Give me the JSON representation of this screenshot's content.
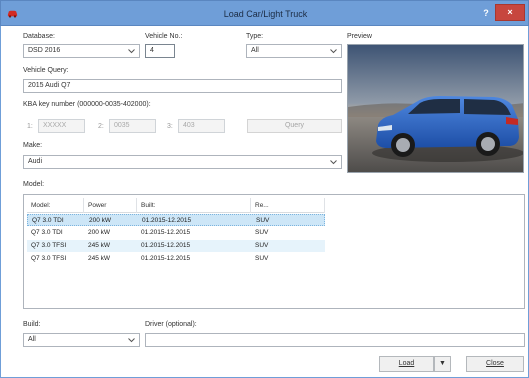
{
  "window": {
    "title": "Load Car/Light Truck",
    "help_glyph": "?",
    "close_glyph": "×"
  },
  "form": {
    "database": {
      "label": "Database:",
      "value": "DSD 2016"
    },
    "vehicle_no": {
      "label": "Vehicle No.:",
      "value": "4"
    },
    "type": {
      "label": "Type:",
      "value": "All"
    },
    "preview_label": "Preview",
    "vehicle_query": {
      "label": "Vehicle Query:",
      "value": "2015 Audi Q7"
    },
    "kba": {
      "label": "KBA key number (000000-0035-402000):",
      "field1": {
        "num": "1:",
        "value": "XXXXX"
      },
      "field2": {
        "num": "2:",
        "value": "0035"
      },
      "field3": {
        "num": "3:",
        "value": "403"
      },
      "query_button": "Query"
    },
    "make": {
      "label": "Make:",
      "value": "Audi"
    },
    "model_label": "Model:",
    "build": {
      "label": "Build:",
      "value": "All"
    },
    "driver": {
      "label": "Driver (optional):",
      "value": ""
    }
  },
  "model_table": {
    "columns": [
      "Model:",
      "Power",
      "Built:",
      "Re..."
    ],
    "rows": [
      {
        "model": "Q7 3.0 TDI",
        "power": "200 kW",
        "built": "01.2015-12.2015",
        "re": "SUV",
        "state": "selected"
      },
      {
        "model": "Q7 3.0 TDI",
        "power": "200 kW",
        "built": "01.2015-12.2015",
        "re": "SUV",
        "state": "normal"
      },
      {
        "model": "Q7 3.0 TFSI",
        "power": "245 kW",
        "built": "01.2015-12.2015",
        "re": "SUV",
        "state": "alt"
      },
      {
        "model": "Q7 3.0 TFSI",
        "power": "245 kW",
        "built": "01.2015-12.2015",
        "re": "SUV",
        "state": "normal"
      }
    ]
  },
  "buttons": {
    "load": "Load",
    "load_dropdown_glyph": "▼",
    "close": "Close"
  },
  "colors": {
    "titlebar": "#6f9ed8",
    "close": "#c7463e",
    "selected_row": "#cde6f7",
    "car_body": "#2a62c4"
  }
}
